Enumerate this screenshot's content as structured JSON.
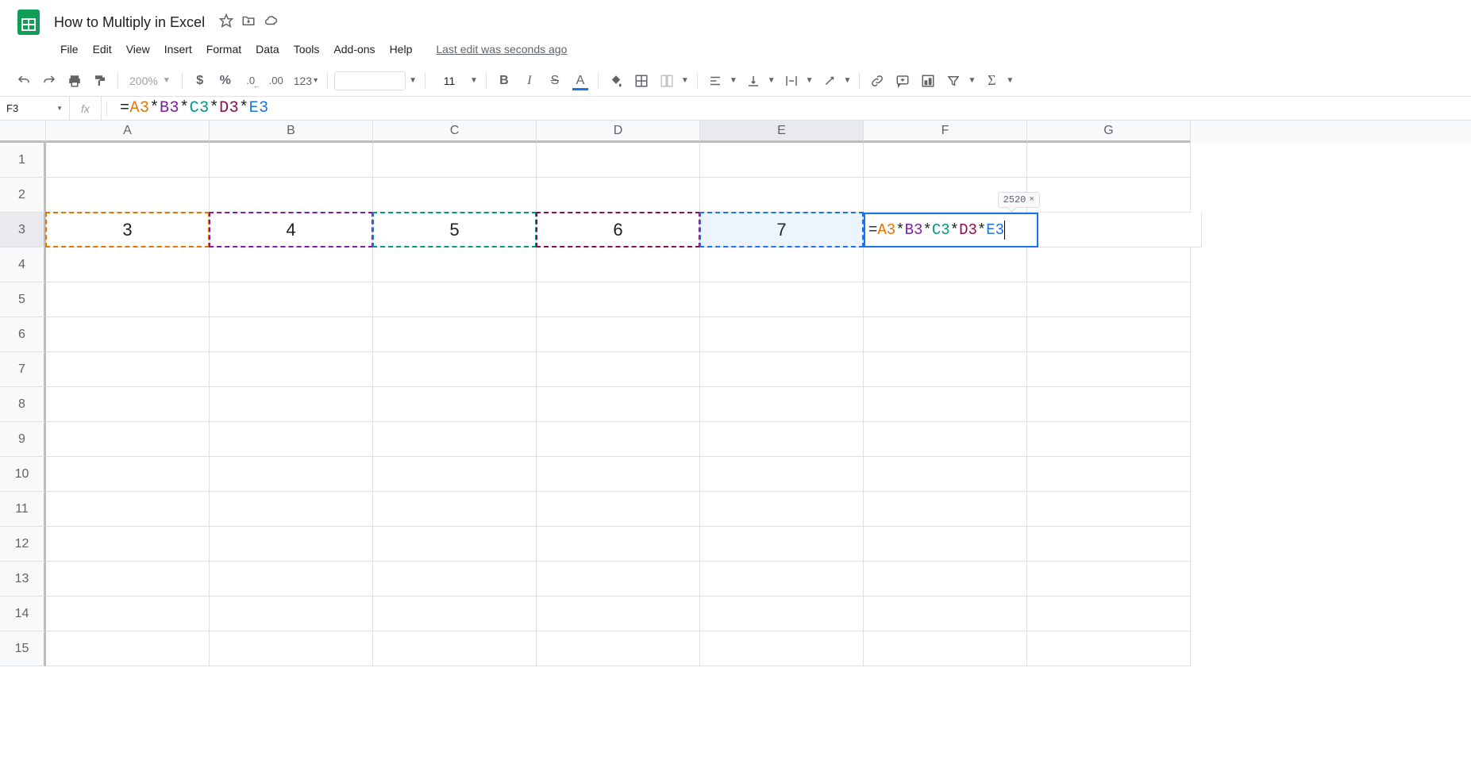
{
  "doc": {
    "title": "How to Multiply in Excel"
  },
  "last_edit": "Last edit was seconds ago",
  "menu": [
    "File",
    "Edit",
    "View",
    "Insert",
    "Format",
    "Data",
    "Tools",
    "Add-ons",
    "Help"
  ],
  "toolbar": {
    "zoom": "200%",
    "font_size": "11",
    "format_more": "123"
  },
  "name_box": "F3",
  "formula": {
    "eq": "=",
    "a": "A3",
    "b": "B3",
    "c": "C3",
    "d": "D3",
    "e": "E3",
    "op": "*"
  },
  "columns": [
    "A",
    "B",
    "C",
    "D",
    "E",
    "F",
    "G"
  ],
  "rows": [
    "1",
    "2",
    "3",
    "4",
    "5",
    "6",
    "7",
    "8",
    "9",
    "10",
    "11",
    "12",
    "13",
    "14",
    "15"
  ],
  "cells": {
    "A3": "3",
    "B3": "4",
    "C3": "5",
    "D3": "6",
    "E3": "7"
  },
  "tooltip": {
    "result": "2520"
  },
  "selected_column_index": 4,
  "selected_row_index": 2
}
